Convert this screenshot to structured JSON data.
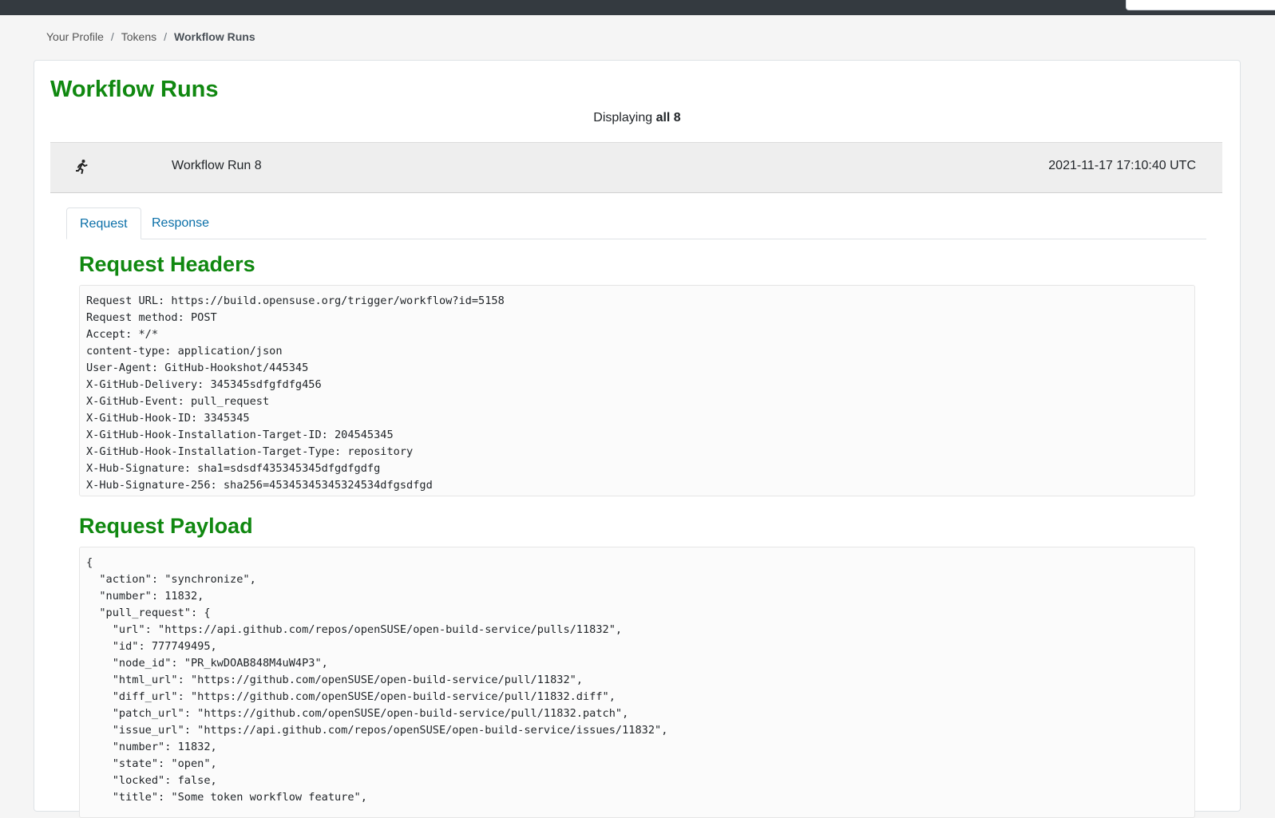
{
  "breadcrumb": {
    "items": [
      "Your Profile",
      "Tokens"
    ],
    "separator": "/",
    "current": "Workflow Runs"
  },
  "page": {
    "title": "Workflow Runs",
    "displaying_prefix": "Displaying",
    "displaying_count": "all 8"
  },
  "run": {
    "icon": "running-person-icon",
    "name": "Workflow Run 8",
    "timestamp": "2021-11-17 17:10:40 UTC"
  },
  "tabs": {
    "request": "Request",
    "response": "Response",
    "active": "Request"
  },
  "request_headers": {
    "title": "Request Headers",
    "lines": [
      "Request URL: https://build.opensuse.org/trigger/workflow?id=5158",
      "Request method: POST",
      "Accept: */*",
      "content-type: application/json",
      "User-Agent: GitHub-Hookshot/445345",
      "X-GitHub-Delivery: 345345sdfgfdfg456",
      "X-GitHub-Event: pull_request",
      "X-GitHub-Hook-ID: 3345345",
      "X-GitHub-Hook-Installation-Target-ID: 204545345",
      "X-GitHub-Hook-Installation-Target-Type: repository",
      "X-Hub-Signature: sha1=sdsdf435345345dfgdfgdfg",
      "X-Hub-Signature-256: sha256=45345345345324534dfgsdfgd"
    ]
  },
  "request_payload": {
    "title": "Request Payload",
    "lines": [
      "{",
      "  \"action\": \"synchronize\",",
      "  \"number\": 11832,",
      "  \"pull_request\": {",
      "    \"url\": \"https://api.github.com/repos/openSUSE/open-build-service/pulls/11832\",",
      "    \"id\": 777749495,",
      "    \"node_id\": \"PR_kwDOAB848M4uW4P3\",",
      "    \"html_url\": \"https://github.com/openSUSE/open-build-service/pull/11832\",",
      "    \"diff_url\": \"https://github.com/openSUSE/open-build-service/pull/11832.diff\",",
      "    \"patch_url\": \"https://github.com/openSUSE/open-build-service/pull/11832.patch\",",
      "    \"issue_url\": \"https://api.github.com/repos/openSUSE/open-build-service/issues/11832\",",
      "    \"number\": 11832,",
      "    \"state\": \"open\",",
      "    \"locked\": false,",
      "    \"title\": \"Some token workflow feature\","
    ]
  },
  "colors": {
    "heading_green": "#108810",
    "link_blue": "#0a6fa8",
    "topbar": "#343a40"
  }
}
